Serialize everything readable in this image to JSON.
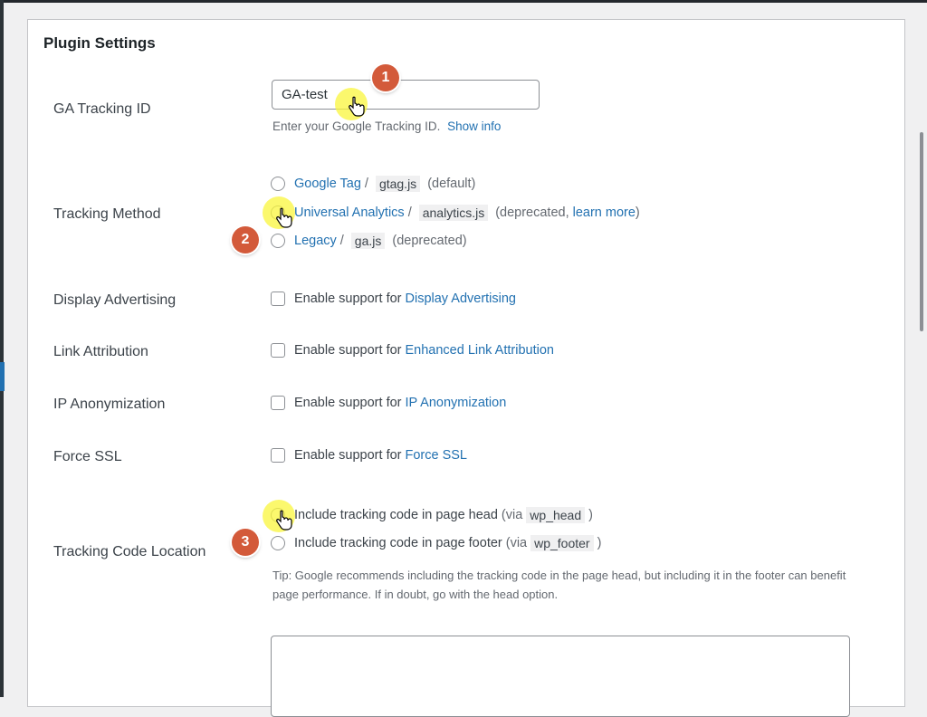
{
  "panel": {
    "title": "Plugin Settings"
  },
  "tracking_id": {
    "label": "GA Tracking ID",
    "value": "GA-test",
    "description": "Enter your Google Tracking ID.",
    "show_info": "Show info"
  },
  "tracking_method": {
    "label": "Tracking Method",
    "options": [
      {
        "link": "Google Tag",
        "sep": "/",
        "code": "gtag.js",
        "suffix": "(default)"
      },
      {
        "link": "Universal Analytics",
        "sep": "/",
        "code": "analytics.js",
        "suffix_pre": "(deprecated,",
        "suffix_link": "learn more",
        "suffix_post": ")"
      },
      {
        "link": "Legacy",
        "sep": "/",
        "code": "ga.js",
        "suffix": "(deprecated)"
      }
    ]
  },
  "display_advertising": {
    "label": "Display Advertising",
    "prefix": "Enable support for",
    "link": "Display Advertising"
  },
  "link_attribution": {
    "label": "Link Attribution",
    "prefix": "Enable support for",
    "link": "Enhanced Link Attribution"
  },
  "ip_anonymization": {
    "label": "IP Anonymization",
    "prefix": "Enable support for",
    "link": "IP Anonymization"
  },
  "force_ssl": {
    "label": "Force SSL",
    "prefix": "Enable support for",
    "link": "Force SSL"
  },
  "tracking_location": {
    "label": "Tracking Code Location",
    "options": [
      {
        "text": "Include tracking code in page head",
        "via": "(via",
        "code": "wp_head",
        "close": ")"
      },
      {
        "text": "Include tracking code in page footer",
        "via": "(via",
        "code": "wp_footer",
        "close": ")"
      }
    ],
    "tip": "Tip: Google recommends including the tracking code in the page head, but including it in the footer can benefit page performance. If in doubt, go with the head option."
  },
  "badges": [
    "1",
    "2",
    "3"
  ],
  "icons": {
    "cursor": "hand-pointer-icon"
  },
  "colors": {
    "link": "#2271b1",
    "badge": "#d35a3a",
    "highlight": "#faf53c"
  }
}
